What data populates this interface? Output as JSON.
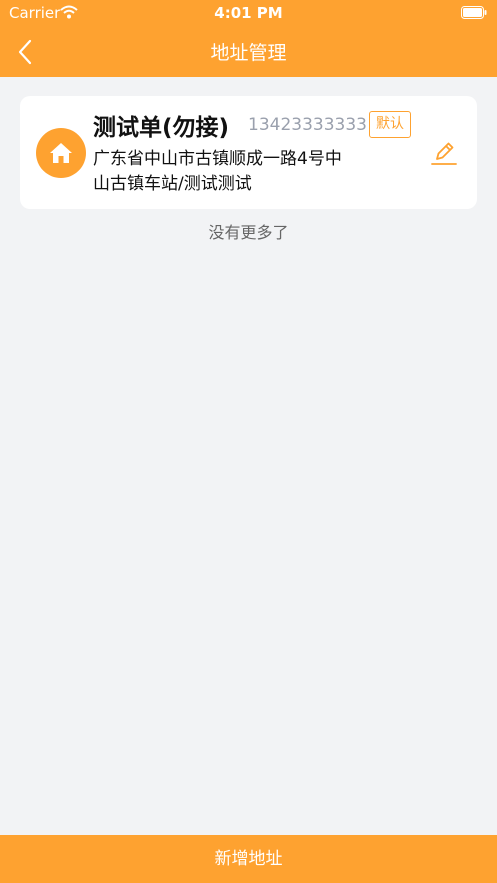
{
  "status_bar": {
    "carrier": "Carrier",
    "time": "4:01 PM"
  },
  "nav": {
    "title": "地址管理"
  },
  "addresses": [
    {
      "name": "测试单(勿接)",
      "phone": "13423333333",
      "badge": "默认",
      "address": "广东省中山市古镇顺成一路4号中山古镇车站/测试测试"
    }
  ],
  "list_footer": "没有更多了",
  "bottom_button": {
    "label": "新增地址"
  },
  "colors": {
    "accent": "#fea230",
    "background": "#f2f3f5"
  }
}
